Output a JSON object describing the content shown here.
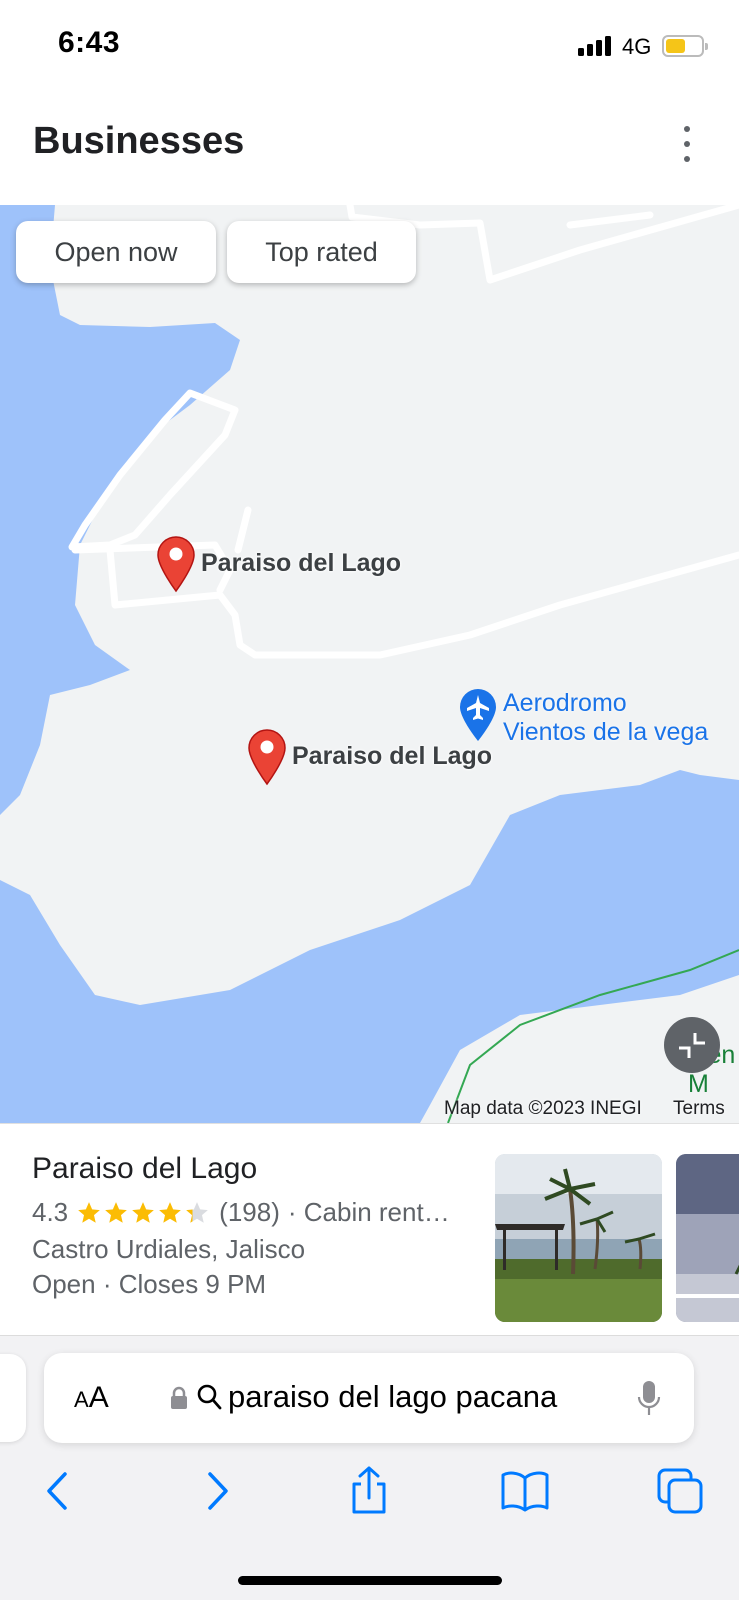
{
  "status_bar": {
    "time": "6:43",
    "network": "4G",
    "battery_fraction": 0.55
  },
  "header": {
    "title": "Businesses",
    "menu_icon": "more-vert-icon"
  },
  "map": {
    "filter_chips": [
      "Open now",
      "Top rated"
    ],
    "pins": [
      {
        "label": "Paraiso del Lago"
      },
      {
        "label": "Paraiso del Lago"
      }
    ],
    "airport": {
      "line1": "Aerodromo",
      "line2": "Vientos de la vega",
      "icon": "airplane-icon"
    },
    "partial_place_label": "Lien\nM",
    "attribution": "Map data ©2023 INEGI",
    "terms": "Terms",
    "colors": {
      "water": "#9ec2fa",
      "land": "#f1f3f4",
      "pin": "#ea4335",
      "airport": "#1a73e8",
      "road": "#ffffff"
    }
  },
  "result": {
    "name": "Paraiso del Lago",
    "rating": "4.3",
    "stars": 4.3,
    "reviews": "(198)",
    "category": "· Cabin rent…",
    "address": "Castro Urdiales, Jalisco",
    "status": "Open",
    "closes": " · Closes 9 PM"
  },
  "browser": {
    "aa_label_small": "A",
    "aa_label_large": "A",
    "url": "paraiso del lago pacana",
    "toolbar": [
      "back-icon",
      "forward-icon",
      "share-icon",
      "bookmarks-icon",
      "tabs-icon"
    ],
    "accent": "#007aff"
  }
}
